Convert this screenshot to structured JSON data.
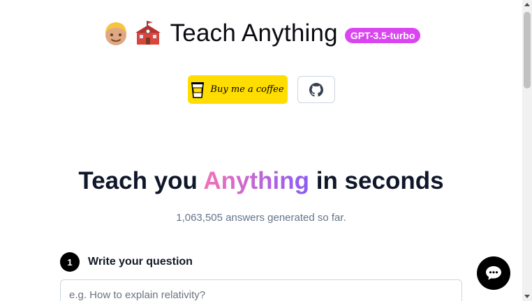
{
  "header": {
    "emoji_1": "teacher-face-icon",
    "emoji_2": "school-icon",
    "title": "Teach Anything",
    "badge": "GPT-3.5-turbo"
  },
  "buttons": {
    "coffee_label": "Buy me a coffee",
    "coffee_icon": "coffee-cup-icon",
    "github_icon": "github-icon",
    "coffee_color": "#ffdd00"
  },
  "hero": {
    "part_1": "Teach you ",
    "highlight": "Anything",
    "part_2": " in seconds",
    "subtitle": "1,063,505 answers generated so far."
  },
  "step": {
    "number": "1",
    "label": "Write your question"
  },
  "question_input": {
    "placeholder": "e.g. How to explain relativity?",
    "value": ""
  },
  "chat": {
    "icon": "chat-bubble-icon"
  },
  "colors": {
    "badge": "#d946ef",
    "gradient_start": "#f472b6",
    "gradient_end": "#8b5cf6"
  }
}
